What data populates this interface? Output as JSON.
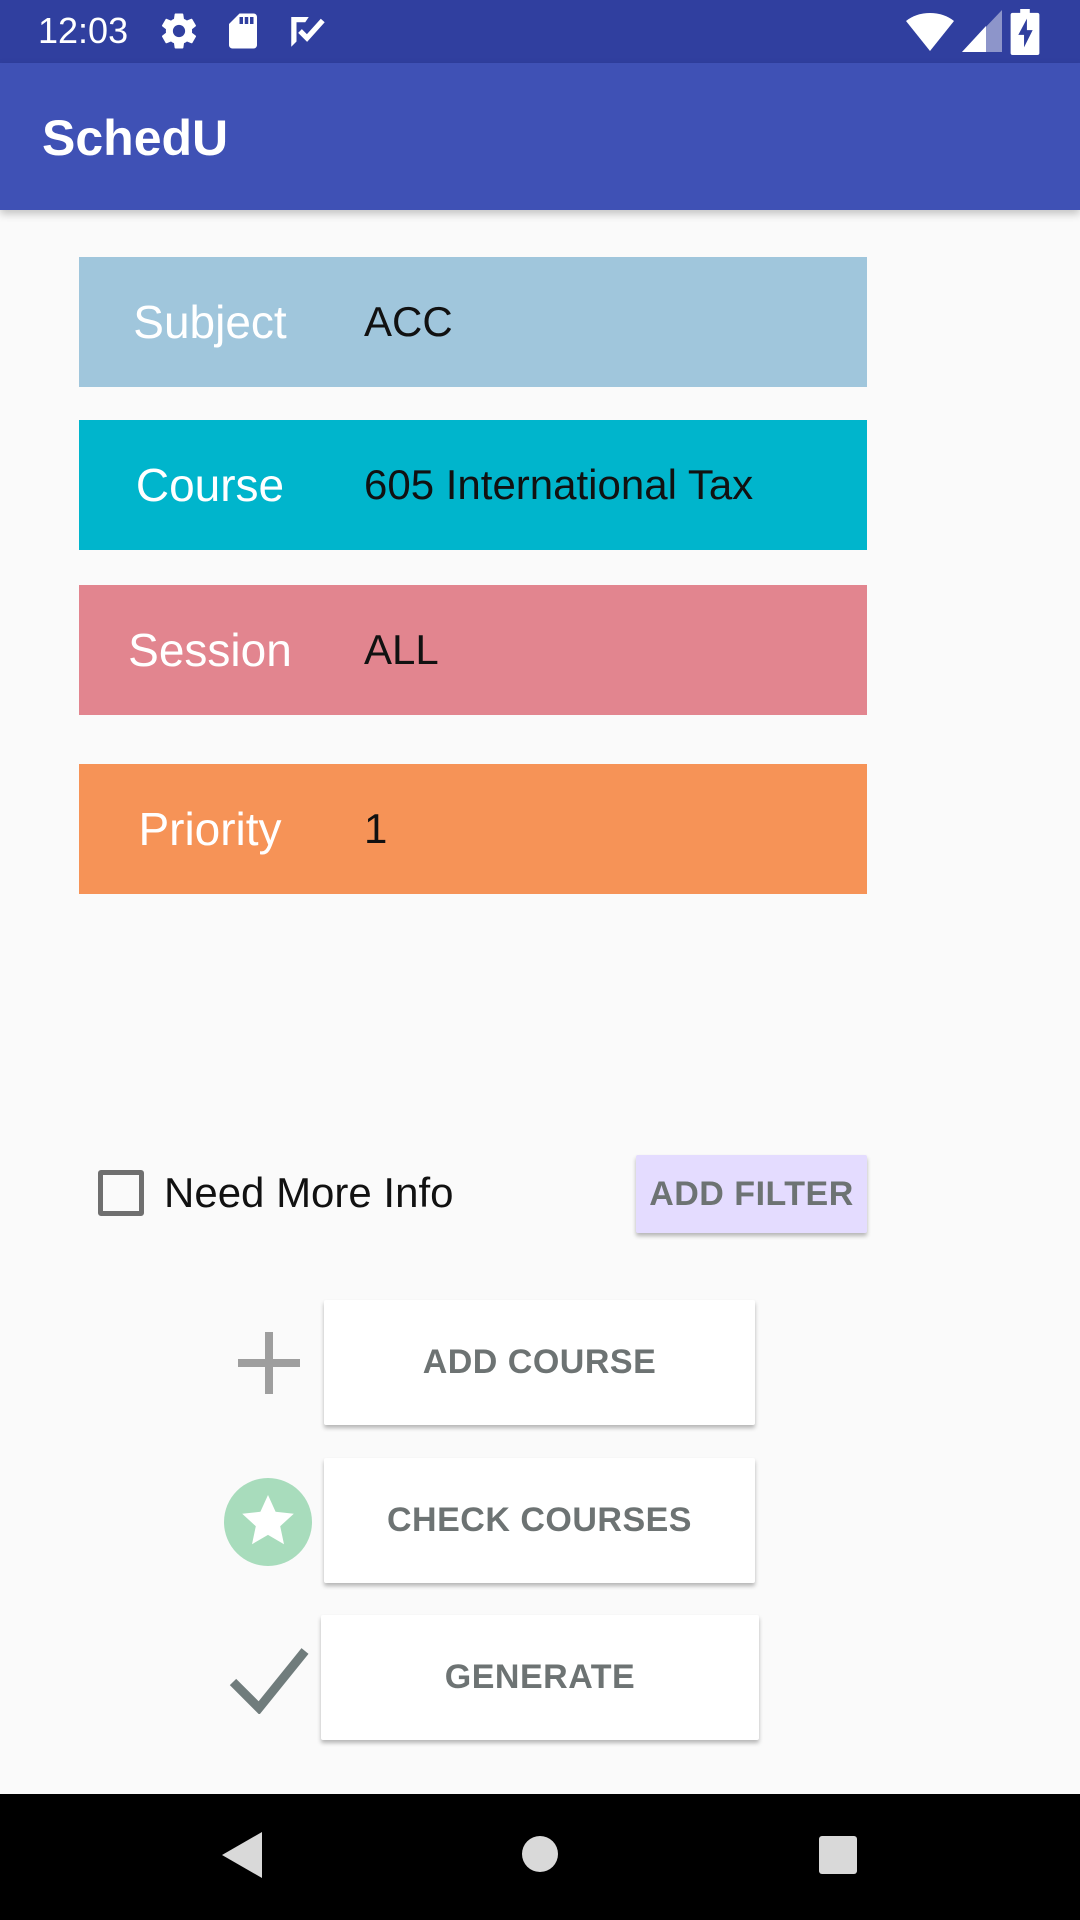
{
  "status_bar": {
    "time": "12:03",
    "icons": [
      "settings-icon",
      "sd-card-icon",
      "task-check-icon",
      "wifi-icon",
      "signal-icon",
      "battery-charging-icon"
    ],
    "color": "#303f9f"
  },
  "app_bar": {
    "title": "SchedU",
    "color": "#3f51b5"
  },
  "fields": [
    {
      "label": "Subject",
      "value": "ACC",
      "color": "#a0c6dc"
    },
    {
      "label": "Course",
      "value": "605 International Tax",
      "color": "#00b5cc"
    },
    {
      "label": "Session",
      "value": "ALL",
      "color": "#e2858f"
    },
    {
      "label": "Priority",
      "value": "1",
      "color": "#f69357"
    }
  ],
  "need_more_info": {
    "label": "Need More Info",
    "checked": false
  },
  "add_filter": {
    "label": "ADD FILTER",
    "color": "#e4dcff"
  },
  "actions": [
    {
      "label": "ADD COURSE",
      "icon": "plus-icon"
    },
    {
      "label": "CHECK COURSES",
      "icon": "star-badge-icon"
    },
    {
      "label": "GENERATE",
      "icon": "checkmark-icon"
    }
  ],
  "nav_bar": {
    "icons": [
      "back-icon",
      "home-icon",
      "recents-icon"
    ]
  }
}
